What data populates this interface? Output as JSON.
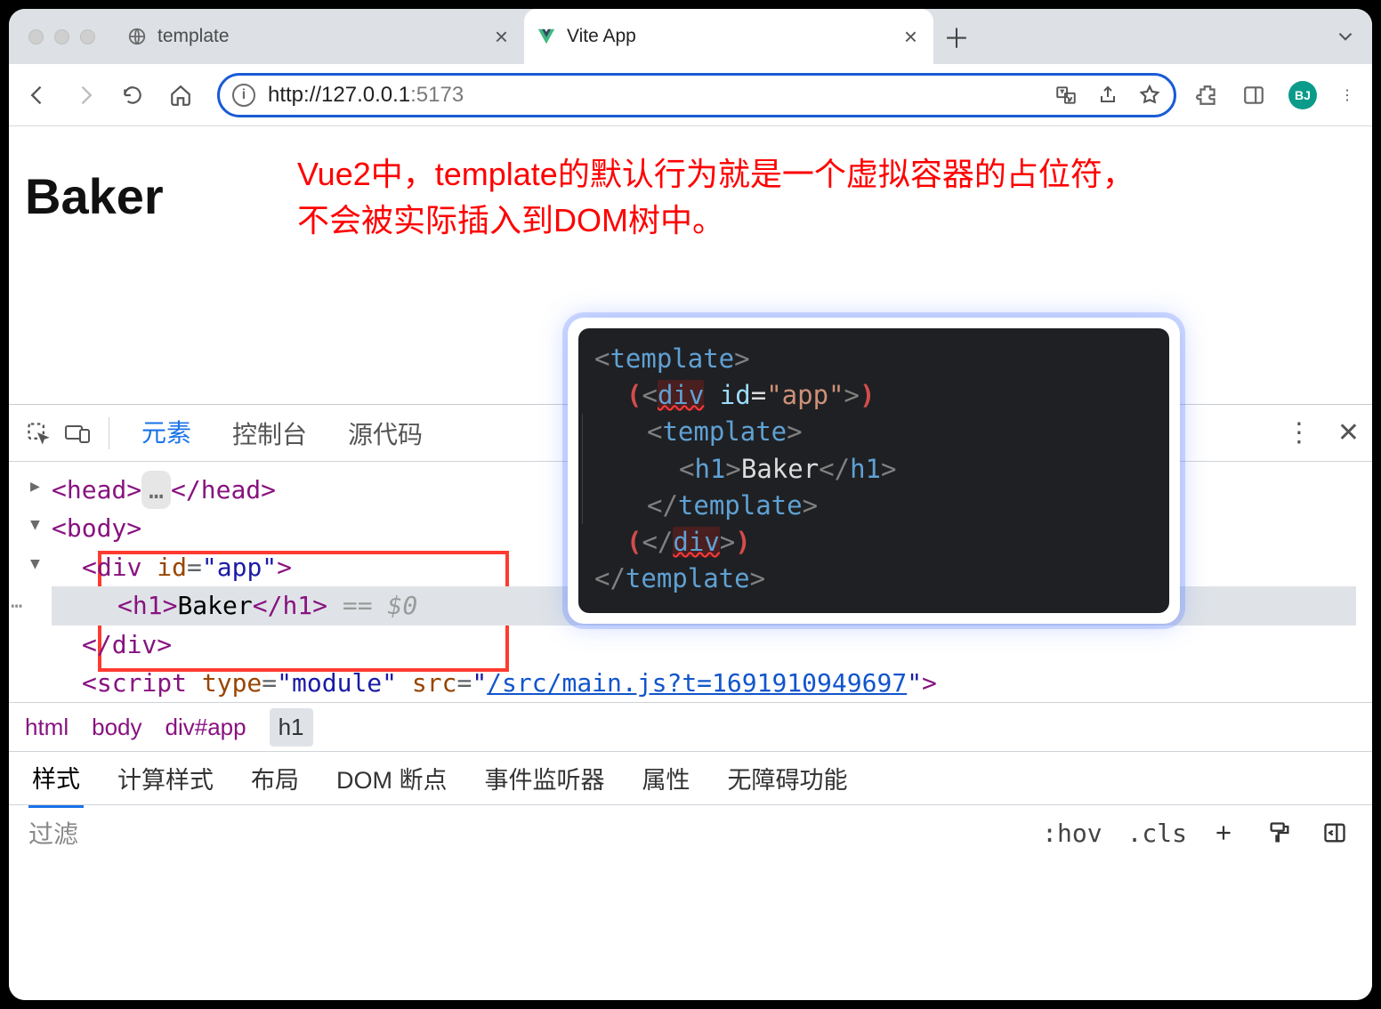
{
  "tabs": {
    "inactive": {
      "title": "template"
    },
    "active": {
      "title": "Vite App"
    }
  },
  "omnibox": {
    "host": "http://127.0.0.1",
    "port": ":5173"
  },
  "avatar": "BJ",
  "page": {
    "heading": "Baker",
    "annotation_line1": "Vue2中，template的默认行为就是一个虚拟容器的占位符，",
    "annotation_line2": "不会被实际插入到DOM树中。"
  },
  "code_overlay": {
    "l1_open": "<",
    "l1_tag": "template",
    "l1_close": ">",
    "l2_lb": "(",
    "l2_open": "<",
    "l2_tag": "div",
    "l2_sp": " ",
    "l2_attr": "id",
    "l2_eq": "=",
    "l2_val": "\"app\"",
    "l2_close": ">",
    "l2_rb": ")",
    "l3_open": "<",
    "l3_tag": "template",
    "l3_close": ">",
    "l4_open": "<",
    "l4_tag": "h1",
    "l4_close": ">",
    "l4_text": "Baker",
    "l4_copen": "</",
    "l4_ctag": "h1",
    "l4_cclose": ">",
    "l5_open": "</",
    "l5_tag": "template",
    "l5_close": ">",
    "l6_lb": "(",
    "l6_open": "</",
    "l6_tag": "div",
    "l6_close": ">",
    "l6_rb": ")",
    "l7_open": "</",
    "l7_tag": "template",
    "l7_close": ">"
  },
  "devtools": {
    "tabs": {
      "elements": "元素",
      "console": "控制台",
      "sources": "源代码"
    },
    "dom": {
      "head_open": "<head>",
      "head_ellipsis": "…",
      "head_close": "</head>",
      "body_open": "<body>",
      "div_open_l": "<div ",
      "div_attr": "id",
      "div_eq": "=",
      "div_val": "\"app\"",
      "div_open_r": ">",
      "h1_open": "<h1>",
      "h1_text": "Baker",
      "h1_close": "</h1>",
      "sel_suffix": " == $0",
      "div_close": "</div>",
      "script_open_l": "<script ",
      "script_attr1": "type",
      "script_eq1": "=",
      "script_val1": "\"module\"",
      "script_sp": " ",
      "script_attr2": "src",
      "script_eq2": "=",
      "script_val2_l": "\"",
      "script_link": "/src/main.js?t=1691910949697",
      "script_val2_r": "\"",
      "script_open_r": ">"
    },
    "breadcrumb": {
      "c1": "html",
      "c2": "body",
      "c3": "div#app",
      "c4": "h1"
    },
    "subtabs": {
      "styles": "样式",
      "computed": "计算样式",
      "layout": "布局",
      "dom_bp": "DOM 断点",
      "listeners": "事件监听器",
      "props": "属性",
      "a11y": "无障碍功能"
    },
    "filter": {
      "placeholder": "过滤",
      "hov": ":hov",
      "cls": ".cls"
    }
  }
}
